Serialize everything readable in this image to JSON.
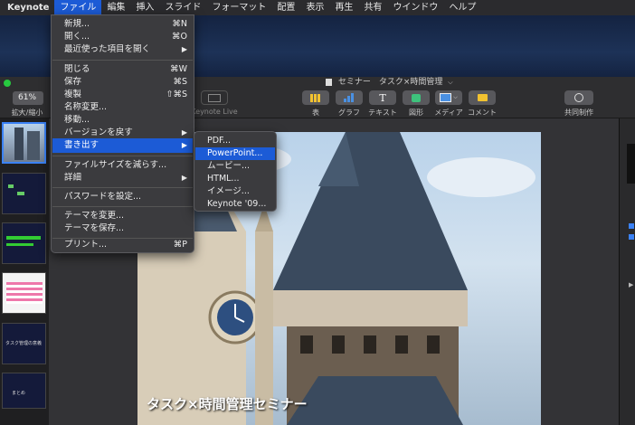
{
  "menubar": {
    "apple": "",
    "app": "Keynote",
    "items": [
      "ファイル",
      "編集",
      "挿入",
      "スライド",
      "フォーマット",
      "配置",
      "表示",
      "再生",
      "共有",
      "ウインドウ",
      "ヘルプ"
    ]
  },
  "window": {
    "title": "セミナー　タスク×時間管理",
    "zoom": "61%",
    "zoom_label": "拡大/縮小",
    "keynote_live": "Keynote Live"
  },
  "toolbar": {
    "table": "表",
    "chart": "グラフ",
    "text": "テキスト",
    "shape": "図形",
    "media": "メディア",
    "comment": "コメント",
    "collab": "共同制作"
  },
  "file_menu": {
    "items": [
      {
        "label": "新規...",
        "shortcut": "⌘N"
      },
      {
        "label": "開く...",
        "shortcut": "⌘O"
      },
      {
        "label": "最近使った項目を開く",
        "submenu": "▶"
      },
      {
        "label": "閉じる",
        "shortcut": "⌘W"
      },
      {
        "label": "保存",
        "shortcut": "⌘S"
      },
      {
        "label": "複製",
        "shortcut": "⇧⌘S"
      },
      {
        "label": "名称変更..."
      },
      {
        "label": "移動..."
      },
      {
        "label": "バージョンを戻す",
        "submenu": "▶"
      },
      {
        "label": "書き出す",
        "submenu": "▶"
      },
      {
        "label": "ファイルサイズを減らす..."
      },
      {
        "label": "詳細",
        "submenu": "▶"
      },
      {
        "label": "パスワードを設定..."
      },
      {
        "label": "テーマを変更..."
      },
      {
        "label": "テーマを保存..."
      },
      {
        "label": "プリント...",
        "shortcut": "⌘P"
      }
    ]
  },
  "export_submenu": {
    "items": [
      "PDF...",
      "PowerPoint...",
      "ムービー...",
      "HTML...",
      "イメージ...",
      "Keynote '09..."
    ]
  },
  "slide": {
    "title": "タスク×時間管理セミナー"
  },
  "thumbnails": {
    "t5": "タスク管理の意義",
    "t6": "まとめ"
  },
  "colors": {
    "highlight": "#1c5bd6",
    "menu_bg": "#3b3b3e",
    "traffic_green": "#27c93f"
  }
}
